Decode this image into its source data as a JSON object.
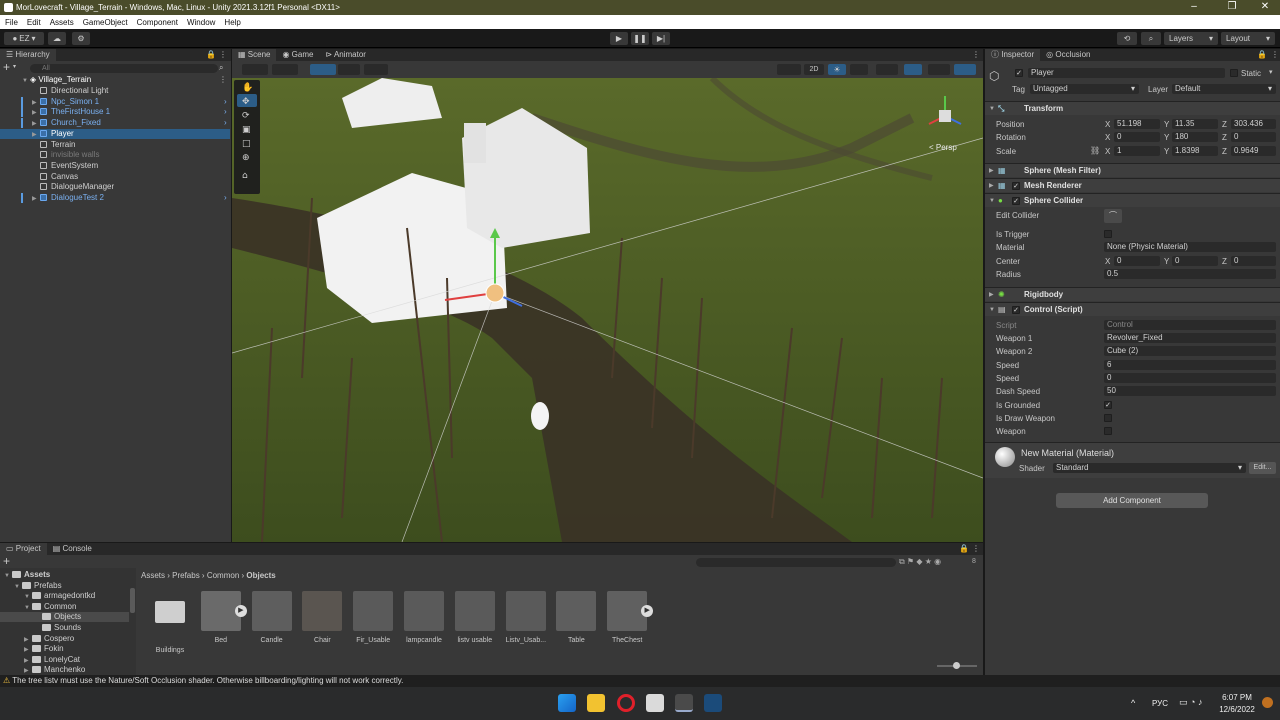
{
  "window": {
    "title": "MorLovecraft - Village_Terrain - Windows, Mac, Linux - Unity 2021.3.12f1 Personal <DX11>"
  },
  "menu": [
    "File",
    "Edit",
    "Assets",
    "GameObject",
    "Component",
    "Window",
    "Help"
  ],
  "toolbar": {
    "account": "EZ",
    "layers": "Layers",
    "layout": "Layout"
  },
  "hierarchy": {
    "tab": "Hierarchy",
    "search_placeholder": "All",
    "scene": "Village_Terrain",
    "items": [
      {
        "label": "Directional Light",
        "style": "normal"
      },
      {
        "label": "Npc_Simon 1",
        "style": "blue"
      },
      {
        "label": "TheFirstHouse 1",
        "style": "blue"
      },
      {
        "label": "Church_Fixed",
        "style": "blue"
      },
      {
        "label": "Player",
        "style": "selected"
      },
      {
        "label": "Terrain",
        "style": "normal"
      },
      {
        "label": "invisible walls",
        "style": "dim"
      },
      {
        "label": "EventSystem",
        "style": "normal"
      },
      {
        "label": "Canvas",
        "style": "normal"
      },
      {
        "label": "DialogueManager",
        "style": "normal"
      },
      {
        "label": "DialogueTest 2",
        "style": "blue"
      }
    ]
  },
  "scene_view": {
    "tabs": [
      "Scene",
      "Game",
      "Animator"
    ],
    "toggle_2d": "2D",
    "gizmo_label": "< Persp"
  },
  "inspector": {
    "tabs": [
      "Inspector",
      "Occlusion"
    ],
    "object_name": "Player",
    "static_label": "Static",
    "tag_label": "Tag",
    "tag_value": "Untagged",
    "layer_label": "Layer",
    "layer_value": "Default",
    "transform": {
      "title": "Transform",
      "position_label": "Position",
      "position": [
        "51.198",
        "11.35",
        "303.436"
      ],
      "rotation_label": "Rotation",
      "rotation": [
        "0",
        "180",
        "0"
      ],
      "scale_label": "Scale",
      "scale": [
        "1",
        "1.8398",
        "0.9649"
      ]
    },
    "components": [
      "Sphere (Mesh Filter)",
      "Mesh Renderer",
      "Sphere Collider",
      "Rigidbody",
      "Control (Script)"
    ],
    "sphere_collider": {
      "edit_collider": "Edit Collider",
      "is_trigger": "Is Trigger",
      "material_label": "Material",
      "material_value": "None (Physic Material)",
      "center_label": "Center",
      "center": [
        "0",
        "0",
        "0"
      ],
      "radius_label": "Radius",
      "radius": "0.5"
    },
    "control_script": {
      "script_label": "Script",
      "script_value": "Control",
      "weapon1_label": "Weapon 1",
      "weapon1_value": "Revolver_Fixed",
      "weapon2_label": "Weapon 2",
      "weapon2_value": "Cube (2)",
      "speed1_label": "Speed",
      "speed1_value": "6",
      "speed2_label": "Speed",
      "speed2_value": "0",
      "dash_label": "Dash Speed",
      "dash_value": "50",
      "grounded_label": "Is Grounded",
      "draw_weapon_label": "Is Draw Weapon",
      "weapon_label": "Weapon"
    },
    "material": {
      "name": "New Material (Material)",
      "shader_label": "Shader",
      "shader_value": "Standard",
      "edit_label": "Edit..."
    },
    "add_component": "Add Component"
  },
  "project": {
    "tabs": [
      "Project",
      "Console"
    ],
    "tree": [
      {
        "label": "Assets",
        "indent": 0
      },
      {
        "label": "Prefabs",
        "indent": 1
      },
      {
        "label": "armagedontkd",
        "indent": 2
      },
      {
        "label": "Common",
        "indent": 2
      },
      {
        "label": "Objects",
        "indent": 3
      },
      {
        "label": "Sounds",
        "indent": 3
      },
      {
        "label": "Cospero",
        "indent": 2
      },
      {
        "label": "Fokin",
        "indent": 2
      },
      {
        "label": "LonelyCat",
        "indent": 2
      },
      {
        "label": "Manchenko",
        "indent": 2
      }
    ],
    "breadcrumb": [
      "Assets",
      "Prefabs",
      "Common",
      "Objects"
    ],
    "assets": [
      "Buildings",
      "Bed",
      "Candle",
      "Chair",
      "Fir_Usable",
      "lampcandle",
      "listv usable",
      "Listv_Usab...",
      "Table",
      "TheChest"
    ],
    "hidden_count": "8"
  },
  "status": {
    "message": "The tree listv must use the Nature/Soft Occlusion shader. Otherwise billboarding/lighting will not work correctly."
  },
  "taskbar": {
    "lang": "РУС",
    "time": "6:07 PM",
    "date": "12/6/2022"
  }
}
